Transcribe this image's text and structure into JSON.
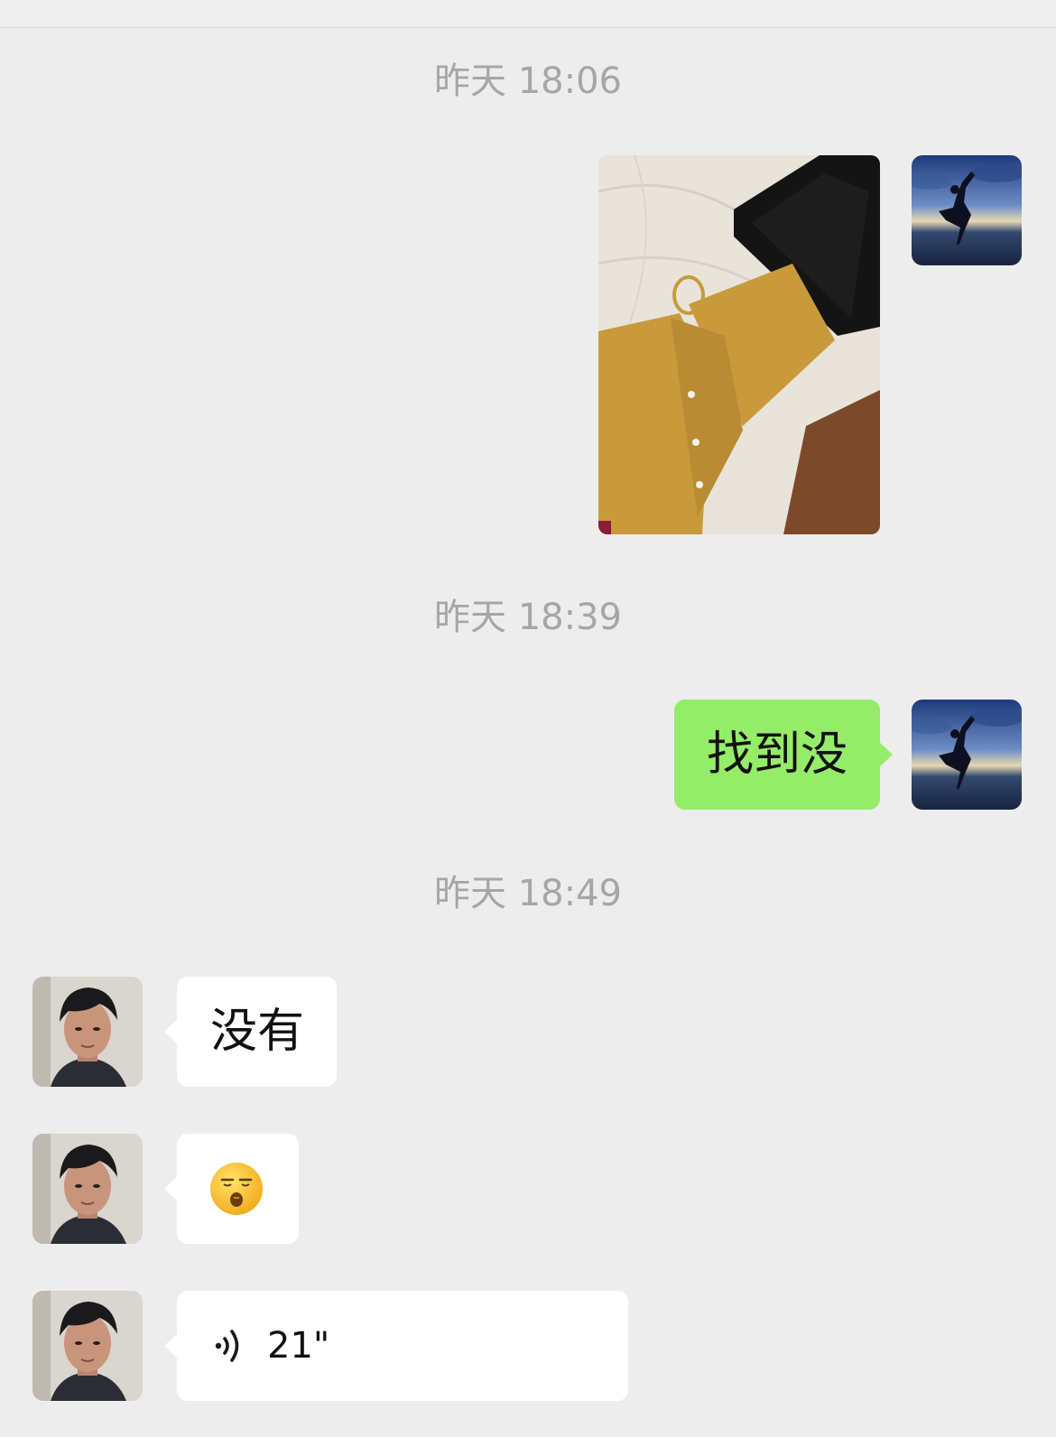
{
  "chat": {
    "timestamps": [
      "昨天 18:06",
      "昨天 18:39",
      "昨天 18:49"
    ],
    "messages": [
      {
        "sender": "me",
        "kind": "image",
        "description": "photo of mustard knit sweater and black pants on white sheet"
      },
      {
        "sender": "me",
        "kind": "text",
        "text": "找到没"
      },
      {
        "sender": "other",
        "kind": "text",
        "text": "没有"
      },
      {
        "sender": "other",
        "kind": "emoji",
        "emoji": "sleeping-face-emoji"
      },
      {
        "sender": "other",
        "kind": "voice",
        "duration": "21\""
      }
    ]
  },
  "colors": {
    "background": "#ededed",
    "outgoing_bubble": "#95ec69",
    "incoming_bubble": "#ffffff",
    "timestamp_text": "#a6a6a6"
  }
}
